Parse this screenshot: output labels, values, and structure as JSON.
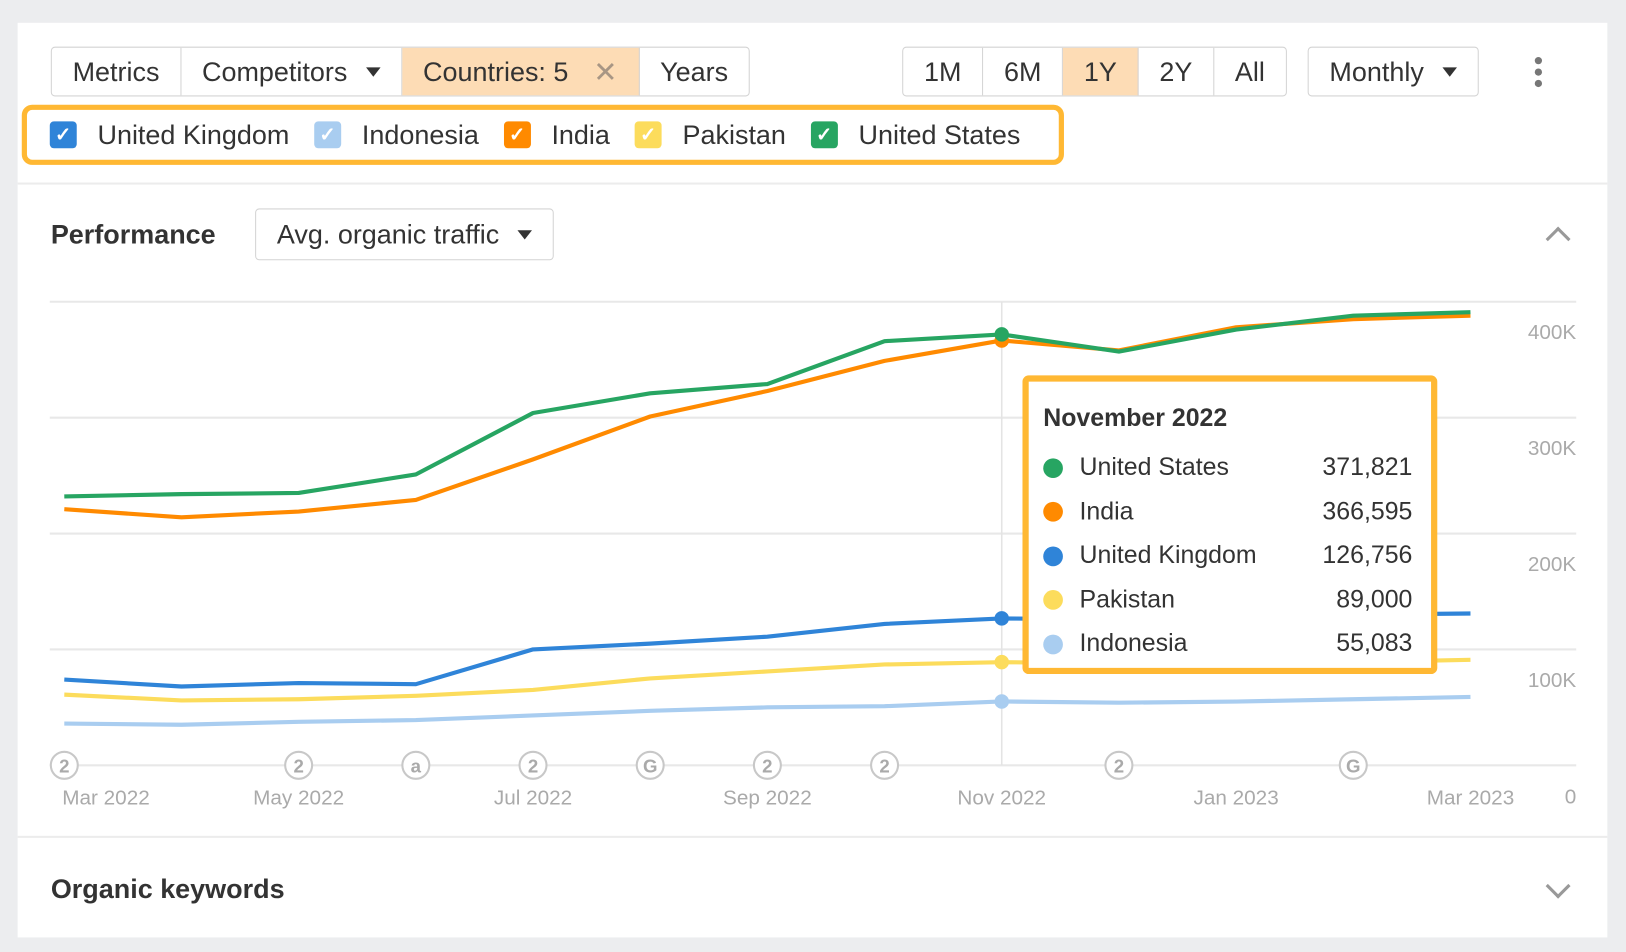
{
  "toolbar": {
    "metrics": "Metrics",
    "competitors": "Competitors",
    "countries": "Countries: 5",
    "years": "Years",
    "ranges": [
      "1M",
      "6M",
      "1Y",
      "2Y",
      "All"
    ],
    "active_range": "1Y",
    "interval": "Monthly"
  },
  "legend": [
    {
      "name": "United Kingdom",
      "color": "#2f84d8",
      "checked": true
    },
    {
      "name": "Indonesia",
      "color": "#a9cdf0",
      "checked": true
    },
    {
      "name": "India",
      "color": "#ff8a00",
      "checked": true
    },
    {
      "name": "Pakistan",
      "color": "#fcdc5c",
      "checked": true
    },
    {
      "name": "United States",
      "color": "#27a562",
      "checked": true
    }
  ],
  "performance": {
    "title": "Performance",
    "metric": "Avg. organic traffic"
  },
  "organic_keywords": {
    "title": "Organic keywords"
  },
  "tooltip": {
    "title": "November 2022",
    "rows": [
      {
        "name": "United States",
        "value": "371,821",
        "color": "#27a562"
      },
      {
        "name": "India",
        "value": "366,595",
        "color": "#ff8a00"
      },
      {
        "name": "United Kingdom",
        "value": "126,756",
        "color": "#2f84d8"
      },
      {
        "name": "Pakistan",
        "value": "89,000",
        "color": "#fcdc5c"
      },
      {
        "name": "Indonesia",
        "value": "55,083",
        "color": "#a9cdf0"
      }
    ]
  },
  "chart_data": {
    "type": "line",
    "x": [
      "Mar 2022",
      "Apr 2022",
      "May 2022",
      "Jun 2022",
      "Jul 2022",
      "Aug 2022",
      "Sep 2022",
      "Oct 2022",
      "Nov 2022",
      "Dec 2022",
      "Jan 2023",
      "Feb 2023",
      "Mar 2023"
    ],
    "x_tick_labels": [
      "Mar 2022",
      "May 2022",
      "Jul 2022",
      "Sep 2022",
      "Nov 2022",
      "Jan 2023",
      "Mar 2023"
    ],
    "y_tick_labels": [
      "0",
      "100K",
      "200K",
      "300K",
      "400K"
    ],
    "ylim": [
      0,
      400000
    ],
    "grid": true,
    "highlight": "Nov 2022",
    "series": [
      {
        "name": "United States",
        "color": "#27a562",
        "values": [
          232000,
          234000,
          235000,
          251000,
          304000,
          321000,
          329000,
          366000,
          371821,
          357000,
          376000,
          388000,
          391000
        ]
      },
      {
        "name": "India",
        "color": "#ff8a00",
        "values": [
          221000,
          214000,
          219000,
          229000,
          264000,
          301000,
          323000,
          349000,
          366595,
          358000,
          378000,
          385000,
          388000
        ]
      },
      {
        "name": "United Kingdom",
        "color": "#2f84d8",
        "values": [
          74000,
          68000,
          71000,
          70000,
          100000,
          105000,
          111000,
          122000,
          126756,
          126000,
          128000,
          130000,
          131000
        ]
      },
      {
        "name": "Pakistan",
        "color": "#fcdc5c",
        "values": [
          61000,
          56000,
          57000,
          60000,
          65000,
          75000,
          81000,
          87000,
          89000,
          88000,
          88000,
          89000,
          91000
        ]
      },
      {
        "name": "Indonesia",
        "color": "#a9cdf0",
        "values": [
          36000,
          35000,
          37500,
          39000,
          43000,
          47000,
          50000,
          51000,
          55083,
          54000,
          55000,
          57000,
          59000
        ]
      }
    ],
    "annotations": [
      {
        "x": "Mar 2022",
        "label": "2"
      },
      {
        "x": "May 2022",
        "label": "2"
      },
      {
        "x": "Jun 2022",
        "label": "a"
      },
      {
        "x": "Jul 2022",
        "label": "2"
      },
      {
        "x": "Aug 2022",
        "label": "G"
      },
      {
        "x": "Sep 2022",
        "label": "2"
      },
      {
        "x": "Oct 2022",
        "label": "2"
      },
      {
        "x": "Dec 2022",
        "label": "2"
      },
      {
        "x": "Feb 2023",
        "label": "G"
      }
    ]
  }
}
